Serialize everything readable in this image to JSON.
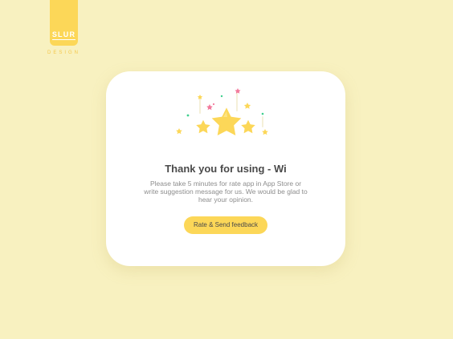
{
  "brand": {
    "logo_text": "SLUR",
    "subtitle": "DESIGN",
    "color": "#fcd758"
  },
  "dialog": {
    "icon": "rating-stars-illustration",
    "title": "Thank you for using - Wi",
    "description": "Please take 5 minutes for rate app in  App Store or write suggestion  message for us. We would be glad to hear your opinion.",
    "button_label": "Rate & Send feedback",
    "button_color": "#fcd758"
  },
  "colors": {
    "background": "#f8f1c0",
    "card": "#ffffff",
    "star": "#fcd758",
    "confetti_pink": "#f27a9c",
    "confetti_green": "#3fcf8e"
  }
}
